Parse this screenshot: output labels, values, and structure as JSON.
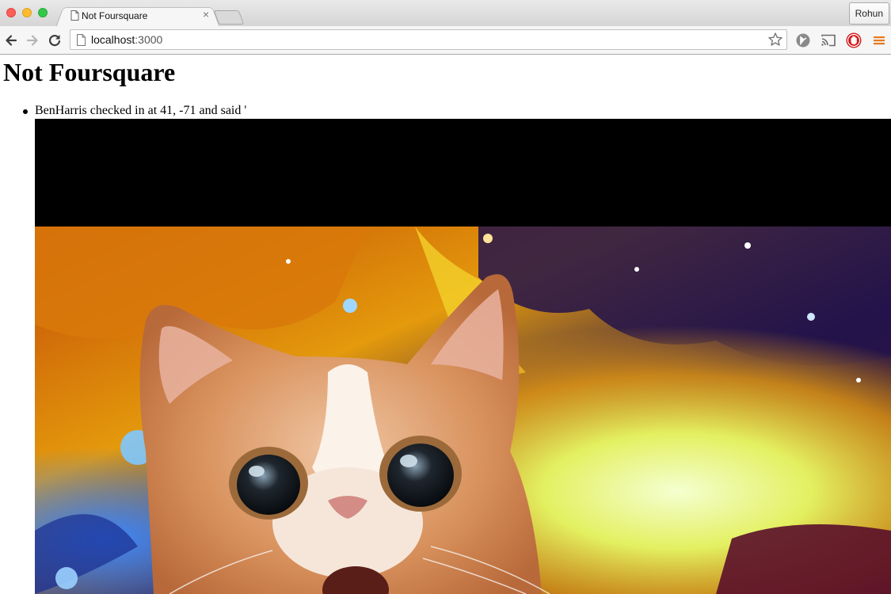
{
  "browser": {
    "tab": {
      "title": "Not Foursquare",
      "close_glyph": "×"
    },
    "profile_name": "Rohun",
    "omnibox": {
      "host": "localhost",
      "port": ":3000"
    },
    "icons": [
      "back-icon",
      "forward-icon",
      "reload-icon",
      "page-icon",
      "bookmark-star-icon",
      "extension-icon",
      "cast-icon",
      "adblock-icon",
      "menu-icon"
    ]
  },
  "page": {
    "heading": "Not Foursquare",
    "checkins": [
      {
        "text": "BenHarris checked in at 41, -71 and said '",
        "photo_alt": "cat-in-space-photo"
      }
    ]
  },
  "colors": {
    "traffic_red": "#fc5f57",
    "traffic_yellow": "#fdbc2e",
    "traffic_green": "#34c84a",
    "menu_orange": "#e8781c",
    "adblock_red": "#d21a1a"
  }
}
